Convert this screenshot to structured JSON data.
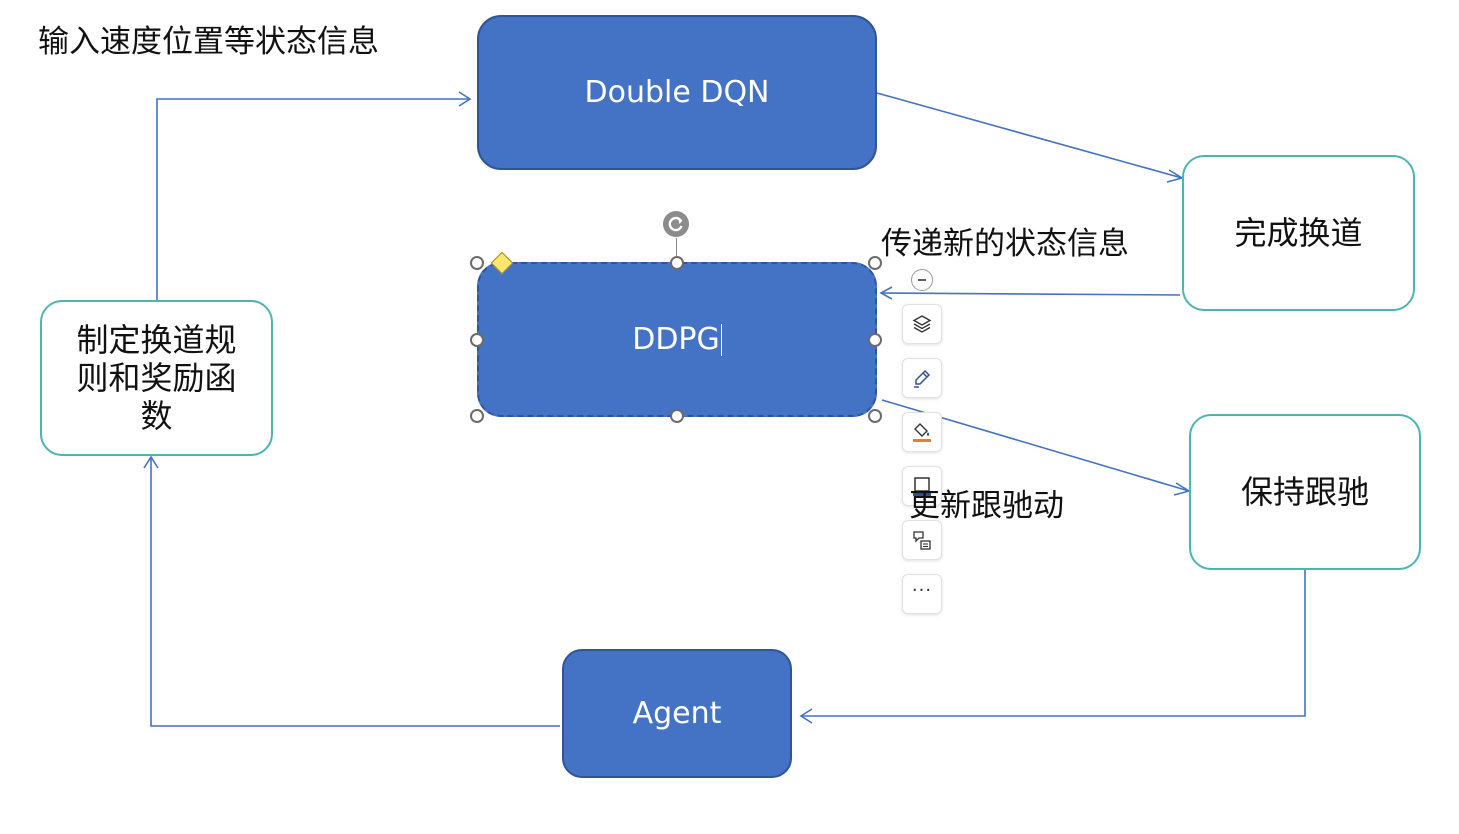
{
  "diagram": {
    "nodes": {
      "double_dqn": "Double DQN",
      "ddpg": "DDPG",
      "agent": "Agent",
      "lane_change_done": "完成换道",
      "keep_following": "保持跟驰",
      "rules": "制定换道规则和奖励函数"
    },
    "labels": {
      "input_state": "输入速度位置等状态信息",
      "pass_state": "传递新的状态信息",
      "update_following": "更新跟驰动"
    }
  },
  "colors": {
    "filled_node": "#4472c4",
    "filled_node_border": "#2f5597",
    "outline_node_border": "#4bb5b0",
    "connector": "#4472c4"
  },
  "shape_toolbar": {
    "icons": [
      "collapse-icon",
      "layers-icon",
      "pen-style-icon",
      "fill-color-icon",
      "outline-icon",
      "alt-text-icon",
      "more-icon"
    ],
    "more_label": "···"
  }
}
